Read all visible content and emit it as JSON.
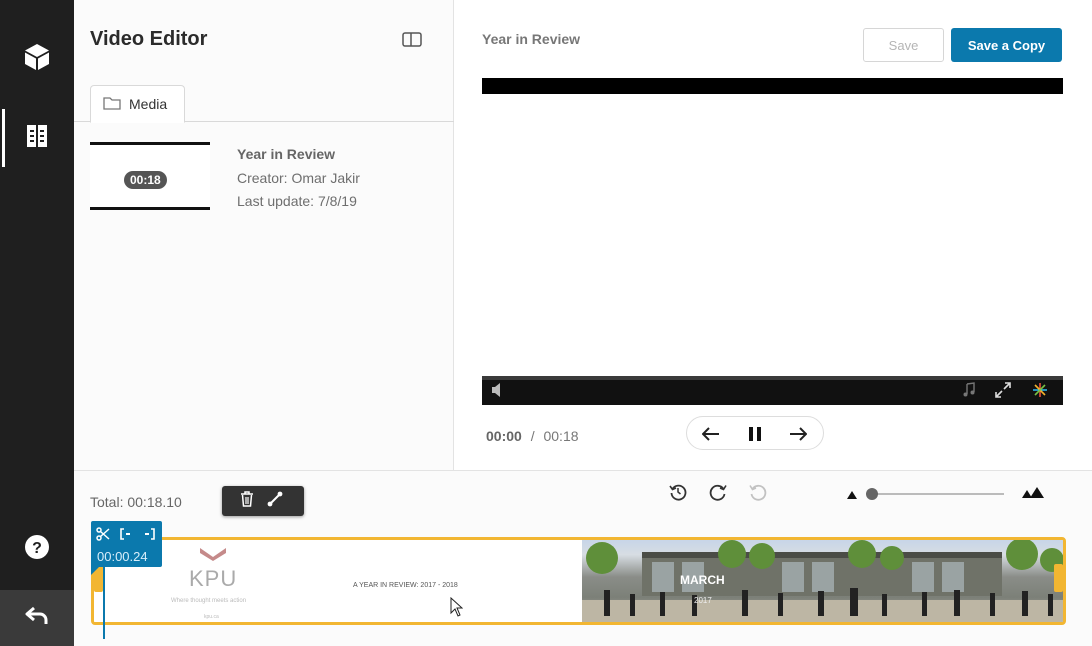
{
  "rail": {
    "items": [
      {
        "name": "cube",
        "active": false
      },
      {
        "name": "book",
        "active": true
      }
    ],
    "help": "help",
    "back": "back"
  },
  "panel": {
    "title": "Video Editor",
    "tab_label": "Media",
    "media": {
      "duration": "00:18",
      "title": "Year in Review",
      "creator": "Creator: Omar Jakir",
      "updated": "Last update: 7/8/19"
    }
  },
  "player": {
    "title": "Year in Review",
    "save_label": "Save",
    "save_copy_label": "Save a Copy",
    "current_time": "00:00",
    "separator": "/",
    "total_time": "00:18"
  },
  "timeline": {
    "total_label": "Total: 00:18.10",
    "playhead_time": "00:00.24",
    "clip1": {
      "logo_text": "KPU",
      "tagline": "Where thought meets action",
      "small_text": "kpu.ca",
      "caption": "A YEAR IN REVIEW: 2017 - 2018"
    },
    "clip2": {
      "month": "MARCH",
      "year": "2017"
    },
    "zoom_level": 0.05
  },
  "colors": {
    "accent": "#0b79ad",
    "trim": "#f2b632",
    "rail": "#1f1f1f"
  }
}
